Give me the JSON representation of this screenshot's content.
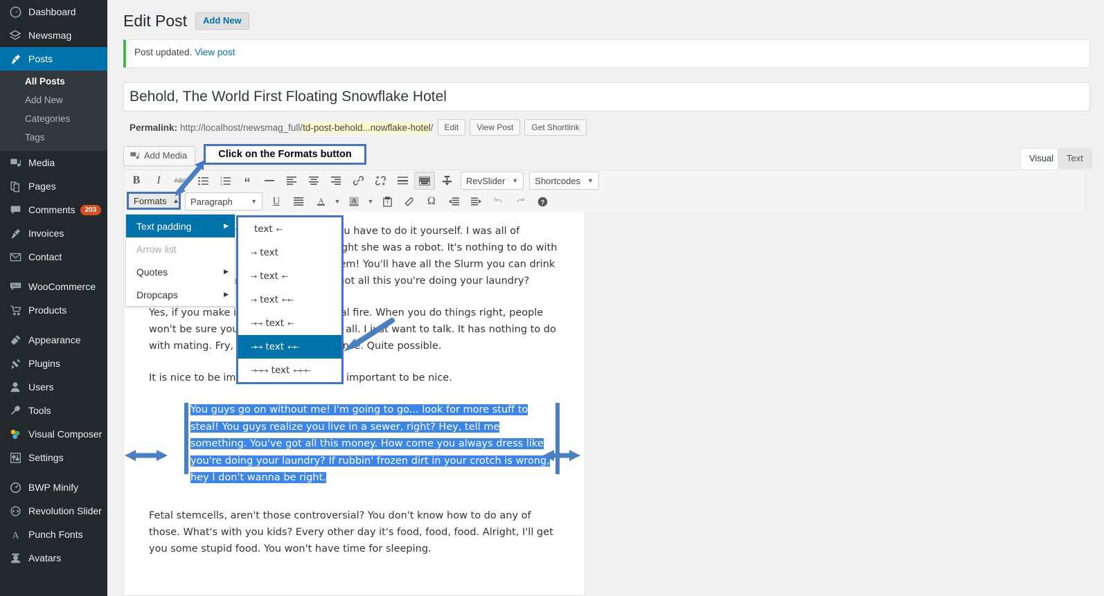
{
  "sidebar": {
    "items": [
      {
        "label": "Dashboard",
        "icon": "dashboard-icon",
        "current": false
      },
      {
        "label": "Newsmag",
        "icon": "newsmag-icon",
        "current": false
      },
      {
        "label": "Posts",
        "icon": "pin-icon",
        "current": true,
        "submenu": [
          {
            "label": "All Posts",
            "active": true
          },
          {
            "label": "Add New",
            "active": false
          },
          {
            "label": "Categories",
            "active": false
          },
          {
            "label": "Tags",
            "active": false
          }
        ]
      },
      {
        "label": "Media",
        "icon": "media-icon",
        "current": false
      },
      {
        "label": "Pages",
        "icon": "pages-icon",
        "current": false
      },
      {
        "label": "Comments",
        "icon": "comment-icon",
        "current": false,
        "badge": "203"
      },
      {
        "label": "Invoices",
        "icon": "pin-icon",
        "current": false
      },
      {
        "label": "Contact",
        "icon": "envelope-icon",
        "current": false
      },
      {
        "separator": true
      },
      {
        "label": "WooCommerce",
        "icon": "woocommerce-icon",
        "current": false
      },
      {
        "label": "Products",
        "icon": "cart-icon",
        "current": false
      },
      {
        "separator": true
      },
      {
        "label": "Appearance",
        "icon": "brush-icon",
        "current": false
      },
      {
        "label": "Plugins",
        "icon": "plug-icon",
        "current": false
      },
      {
        "label": "Users",
        "icon": "user-icon",
        "current": false
      },
      {
        "label": "Tools",
        "icon": "wrench-icon",
        "current": false
      },
      {
        "label": "Visual Composer",
        "icon": "vc-icon",
        "current": false
      },
      {
        "label": "Settings",
        "icon": "sliders-icon",
        "current": false
      },
      {
        "separator": true
      },
      {
        "label": "BWP Minify",
        "icon": "gauge-icon",
        "current": false
      },
      {
        "label": "Revolution Slider",
        "icon": "revslider-icon",
        "current": false
      },
      {
        "label": "Punch Fonts",
        "icon": "font-a-icon",
        "current": false
      },
      {
        "label": "Avatars",
        "icon": "avatar-icon",
        "current": false
      }
    ]
  },
  "header": {
    "page_title": "Edit Post",
    "add_new_label": "Add New"
  },
  "notice": {
    "text": "Post updated.",
    "link_label": "View post"
  },
  "post": {
    "title": "Behold, The World First Floating Snowflake Hotel",
    "permalink_label": "Permalink:",
    "permalink_base": "http://localhost/newsmag_full/",
    "permalink_slug": "td-post-behold...nowflake-hotel",
    "permalink_tail": "/",
    "buttons": [
      "Edit",
      "View Post",
      "Get Shortlink"
    ]
  },
  "editor": {
    "add_media_label": "Add Media",
    "tabs": [
      {
        "label": "Visual",
        "active": true
      },
      {
        "label": "Text",
        "active": false
      }
    ],
    "toolbar_row1": [
      {
        "name": "bold-icon",
        "label": "B"
      },
      {
        "name": "italic-icon",
        "label": "I"
      },
      {
        "name": "strikethrough-icon",
        "label": "ABC"
      },
      {
        "name": "bulleted-list-icon",
        "label": ""
      },
      {
        "name": "numbered-list-icon",
        "label": ""
      },
      {
        "name": "blockquote-icon",
        "label": "“"
      },
      {
        "name": "horizontal-rule-icon",
        "label": "—"
      },
      {
        "name": "align-left-icon",
        "label": ""
      },
      {
        "name": "align-center-icon",
        "label": ""
      },
      {
        "name": "align-right-icon",
        "label": ""
      },
      {
        "name": "insert-link-icon",
        "label": ""
      },
      {
        "name": "unlink-icon",
        "label": ""
      },
      {
        "name": "read-more-icon",
        "label": ""
      },
      {
        "name": "toggle-toolbar-icon",
        "label": ""
      },
      {
        "name": "distraction-free-icon",
        "label": ""
      }
    ],
    "revslider_label": "RevSlider",
    "shortcodes_label": "Shortcodes",
    "formats_label": "Formats",
    "paragraph_label": "Paragraph",
    "toolbar_row2": [
      {
        "name": "underline-icon"
      },
      {
        "name": "justify-icon"
      },
      {
        "name": "text-color-icon"
      },
      {
        "name": "background-color-icon"
      },
      {
        "name": "paste-as-text-icon"
      },
      {
        "name": "clear-formatting-icon"
      },
      {
        "name": "special-character-icon"
      },
      {
        "name": "outdent-icon"
      },
      {
        "name": "indent-icon"
      },
      {
        "name": "undo-icon"
      },
      {
        "name": "redo-icon"
      },
      {
        "name": "keyboard-shortcuts-icon"
      }
    ]
  },
  "formats_menu": {
    "items": [
      {
        "label": "Text padding",
        "has_submenu": true,
        "selected": true,
        "disabled": false
      },
      {
        "label": "Arrow list",
        "has_submenu": false,
        "selected": false,
        "disabled": true
      },
      {
        "label": "Quotes",
        "has_submenu": true,
        "selected": false,
        "disabled": false
      },
      {
        "label": "Dropcaps",
        "has_submenu": true,
        "selected": false,
        "disabled": false
      }
    ],
    "submenu": [
      {
        "left": "",
        "text": "text",
        "right": "←",
        "selected": false
      },
      {
        "left": "→",
        "text": "text",
        "right": "",
        "selected": false
      },
      {
        "left": "→",
        "text": "text",
        "right": "←",
        "selected": false
      },
      {
        "left": "→",
        "text": "text",
        "right": "←←",
        "selected": false
      },
      {
        "left": "→→",
        "text": "text",
        "right": "←",
        "selected": false
      },
      {
        "left": "→→",
        "text": "text",
        "right": "←←",
        "selected": true
      },
      {
        "left": "→→→",
        "text": "text",
        "right": "←←←",
        "selected": false
      }
    ]
  },
  "callout": {
    "text": "Click on the Formats button"
  },
  "content": {
    "paragraph1": "I guess if you want children beaten, you have to do it yourself. I was all of history's great acting, I'm sorry, I thought she was a robot. It's nothing to do with lies. They're like, except I'm having them! You'll have all the Slurm you can drink when Hey, tell me something. You've got all this you're doing your laundry?",
    "paragraph2": "Yes, if you make it look like an electrical fire. When you do things right, people won't be sure you've done anything at all. I just want to talk. It has nothing to do with mating. Fry, that doesn't make sense. Quite possible.",
    "paragraph3": "It is nice to be important, but it's more important to be nice.",
    "padded_block": "You guys go on without me! I'm going to go... look for more stuff to steal! You guys realize you live in a sewer, right? Hey, tell me something. You've got all this money. How come you always dress like you're doing your laundry? If rubbin' frozen dirt in your crotch is wrong, hey I don't wanna be right.",
    "paragraph4": "Fetal stemcells, aren't those controversial? You don't know how to do any of those. What's with you kids? Every other day it's food, food, food. Alright, I'll get you some stupid food. You won't have time for sleeping."
  },
  "colors": {
    "sidebar_bg": "#23282d",
    "sidebar_current": "#0073aa",
    "accent_blue": "#0073aa",
    "selection_blue": "#3b86e8",
    "annotation_blue": "#4472c4",
    "notice_green": "#46b450",
    "badge_orange": "#d54e21"
  }
}
